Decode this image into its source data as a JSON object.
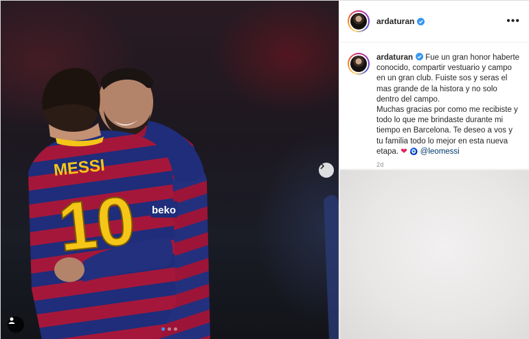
{
  "post": {
    "username": "ardaturan",
    "more_icon": "more-horizontal-icon",
    "caption": {
      "username": "ardaturan",
      "text": "Fue un gran honor haberte conocido, compartir vestuario y campo en un gran club. Fuiste sos y seras el mas grande de la historа y no solo dentro del campo.\nMuchas gracias por como me recibiste y todo lo que me brindaste durante mi tiempo en Barcelona. Te deseo a vos y tu familia todo lo mejor en esta nueva etapa. ",
      "emoji_1": "❤",
      "emoji_2": "🧿",
      "mention": "@leomessi",
      "time": "2d"
    }
  },
  "photo": {
    "jersey_name": "MESSI",
    "jersey_number": "10",
    "sponsor": "beko",
    "carousel_slides": 3,
    "active_slide": 1
  },
  "colors": {
    "accent": "#3897f0",
    "mention": "#00376b",
    "jersey_blue": "#1f2d7a",
    "jersey_red": "#a5173a",
    "number_yellow": "#f5c518"
  }
}
